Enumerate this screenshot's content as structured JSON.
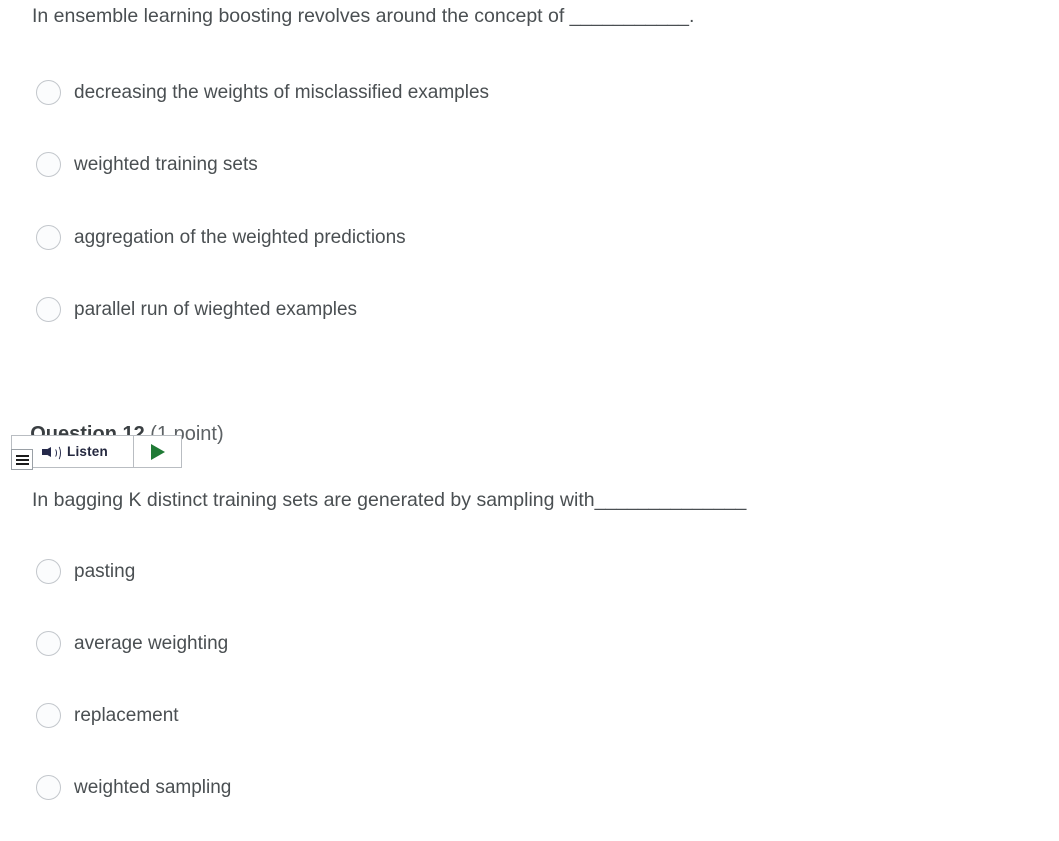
{
  "page": {
    "background_color": "#ffffff",
    "text_color": "#4a4f52"
  },
  "question_11": {
    "stem": "In ensemble learning boosting revolves around the concept of ___________.",
    "options": [
      {
        "label": "decreasing the weights of misclassified examples",
        "selected": false
      },
      {
        "label": "weighted training sets",
        "selected": false
      },
      {
        "label": "aggregation of the weighted predictions",
        "selected": false
      },
      {
        "label": "parallel run of wieghted examples",
        "selected": false
      }
    ]
  },
  "question_12": {
    "header": {
      "title": "Question 12",
      "points": " (1 point)"
    },
    "listen_widget": {
      "label": "Listen",
      "menu_icon": "hamburger-menu-icon",
      "speaker_icon": "speaker-icon",
      "play_icon": "play-triangle-icon",
      "play_color": "#1f7a35",
      "border_color": "#b9bdc2"
    },
    "stem": "In bagging K distinct training sets are generated by sampling with______________",
    "options": [
      {
        "label": "pasting",
        "selected": false
      },
      {
        "label": "average weighting",
        "selected": false
      },
      {
        "label": "replacement",
        "selected": false
      },
      {
        "label": "weighted sampling",
        "selected": false
      }
    ]
  }
}
